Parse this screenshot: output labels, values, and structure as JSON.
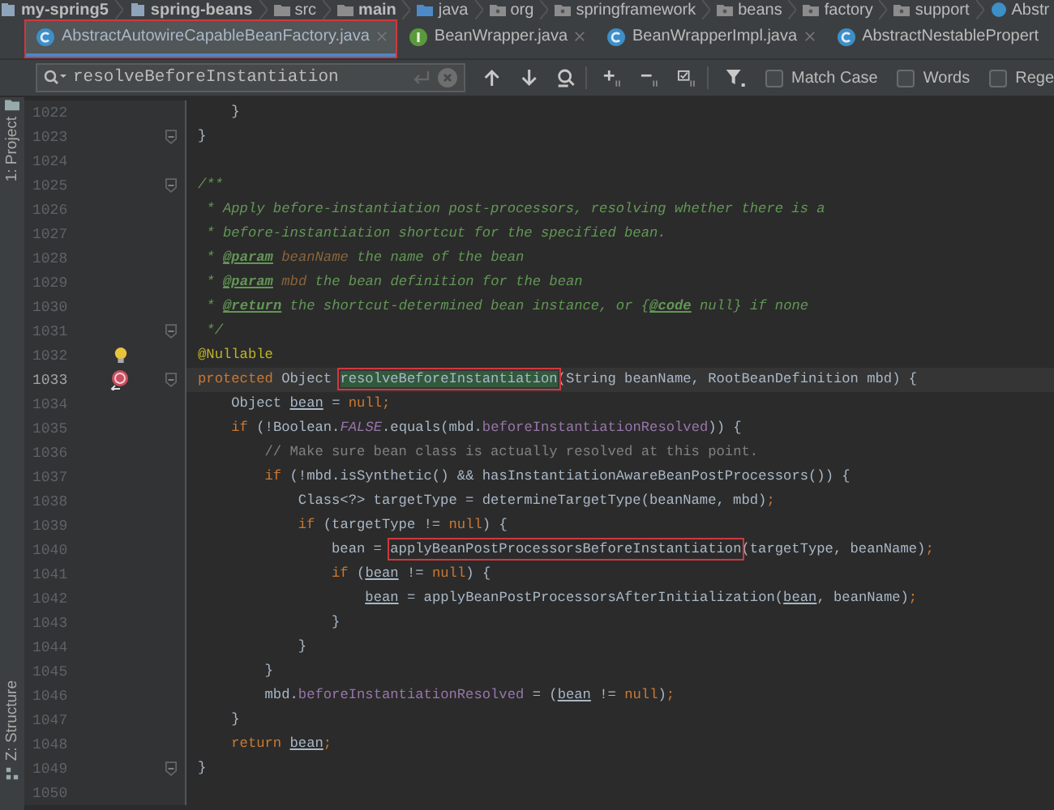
{
  "breadcrumbs": [
    {
      "label": "my-spring5",
      "kind": "module"
    },
    {
      "label": "spring-beans",
      "kind": "module"
    },
    {
      "label": "src",
      "kind": "folder"
    },
    {
      "label": "main",
      "kind": "root"
    },
    {
      "label": "java",
      "kind": "source"
    },
    {
      "label": "org",
      "kind": "package"
    },
    {
      "label": "springframework",
      "kind": "package"
    },
    {
      "label": "beans",
      "kind": "package"
    },
    {
      "label": "factory",
      "kind": "package"
    },
    {
      "label": "support",
      "kind": "package"
    },
    {
      "label": "Abstr",
      "kind": "class"
    }
  ],
  "tabs": [
    {
      "label": "AbstractAutowireCapableBeanFactory.java",
      "kind": "class",
      "selected": true,
      "boxed": true,
      "closable": true
    },
    {
      "label": "BeanWrapper.java",
      "kind": "interface",
      "selected": false,
      "boxed": false,
      "closable": true
    },
    {
      "label": "BeanWrapperImpl.java",
      "kind": "class",
      "selected": false,
      "boxed": false,
      "closable": true
    },
    {
      "label": "AbstractNestablePropert",
      "kind": "class",
      "selected": false,
      "boxed": false,
      "closable": false
    }
  ],
  "search": {
    "value": "resolveBeforeInstantiation",
    "options": [
      {
        "label": "Match Case",
        "checked": false
      },
      {
        "label": "Words",
        "checked": false
      },
      {
        "label": "Rege",
        "checked": false
      }
    ]
  },
  "side_tabs": {
    "top": "1: Project",
    "bottom": "Z: Structure"
  },
  "lines": [
    {
      "number": "1022",
      "fold": false,
      "current": false,
      "tokens": [
        {
          "t": "    }",
          "kind": "p"
        }
      ]
    },
    {
      "number": "1023",
      "fold": true,
      "current": false,
      "tokens": [
        {
          "t": "}",
          "kind": "p"
        }
      ]
    },
    {
      "number": "1024",
      "fold": false,
      "current": false
    },
    {
      "number": "1025",
      "fold": true,
      "current": false,
      "tokens": [
        {
          "t": "/**",
          "kind": "d"
        }
      ]
    },
    {
      "number": "1026",
      "fold": false,
      "current": false,
      "tokens": [
        {
          "t": " * Apply before-instantiation post-processors, resolving whether there is a",
          "kind": "d"
        }
      ]
    },
    {
      "number": "1027",
      "fold": false,
      "current": false,
      "tokens": [
        {
          "t": " * before-instantiation shortcut for the specified bean.",
          "kind": "d"
        }
      ]
    },
    {
      "number": "1028",
      "fold": false,
      "current": false,
      "tokens": [
        {
          "t": " * ",
          "kind": "d"
        },
        {
          "t": "@param",
          "kind": "dt"
        },
        {
          "t": " beanName",
          "kind": "dp"
        },
        {
          "t": " the name of the bean",
          "kind": "d"
        }
      ]
    },
    {
      "number": "1029",
      "fold": false,
      "current": false,
      "tokens": [
        {
          "t": " * ",
          "kind": "d"
        },
        {
          "t": "@param",
          "kind": "dt"
        },
        {
          "t": " mbd",
          "kind": "dp"
        },
        {
          "t": " the bean definition for the bean",
          "kind": "d"
        }
      ]
    },
    {
      "number": "1030",
      "fold": false,
      "current": false,
      "tokens": [
        {
          "t": " * ",
          "kind": "d"
        },
        {
          "t": "@return",
          "kind": "dt"
        },
        {
          "t": " the shortcut-determined bean instance, or {",
          "kind": "d"
        },
        {
          "t": "@code",
          "kind": "dt"
        },
        {
          "t": " null} if none",
          "kind": "d"
        }
      ]
    },
    {
      "number": "1031",
      "fold": true,
      "current": false,
      "tokens": [
        {
          "t": " */",
          "kind": "d"
        }
      ]
    },
    {
      "number": "1032",
      "fold": false,
      "current": false,
      "gutter": {
        "kind": "bulb"
      },
      "tokens": [
        {
          "t": "@Nullable",
          "kind": "a"
        }
      ]
    },
    {
      "number": "1033",
      "fold": true,
      "current": true,
      "gutter": {
        "kind": "override"
      },
      "tokens": [
        {
          "t": "protected",
          "kind": "k"
        },
        {
          "t": " Object ",
          "kind": "p"
        },
        {
          "t": "resolveBeforeInstantiation",
          "kind": "m",
          "boxed": true
        },
        {
          "t": "(String beanName, RootBeanDefinition mbd) {",
          "kind": "p"
        }
      ]
    },
    {
      "number": "1034",
      "fold": false,
      "current": false,
      "tokens": [
        {
          "t": "    Object ",
          "kind": "p"
        },
        {
          "t": "bean",
          "kind": "v"
        },
        {
          "t": " = ",
          "kind": "p"
        },
        {
          "t": "null;",
          "kind": "k"
        }
      ]
    },
    {
      "number": "1035",
      "fold": false,
      "current": false,
      "tokens": [
        {
          "t": "    if",
          "kind": "k"
        },
        {
          "t": " (!Boolean.",
          "kind": "p"
        },
        {
          "t": "FALSE",
          "kind": "s"
        },
        {
          "t": ".equals(mbd.",
          "kind": "p"
        },
        {
          "t": "beforeInstantiationResolved",
          "kind": "f"
        },
        {
          "t": ")) {",
          "kind": "p"
        }
      ]
    },
    {
      "number": "1036",
      "fold": false,
      "current": false,
      "tokens": [
        {
          "t": "        // Make sure bean class is actually resolved at this point.",
          "kind": "c"
        }
      ]
    },
    {
      "number": "1037",
      "fold": false,
      "current": false,
      "tokens": [
        {
          "t": "        if",
          "kind": "k"
        },
        {
          "t": " (!mbd.isSynthetic() && hasInstantiationAwareBeanPostProcessors()) {",
          "kind": "p"
        }
      ]
    },
    {
      "number": "1038",
      "fold": false,
      "current": false,
      "tokens": [
        {
          "t": "            Class<?> targetType = determineTargetType(beanName, mbd)",
          "kind": "p"
        },
        {
          "t": ";",
          "kind": "k"
        }
      ]
    },
    {
      "number": "1039",
      "fold": false,
      "current": false,
      "tokens": [
        {
          "t": "            if",
          "kind": "k"
        },
        {
          "t": " (targetType != ",
          "kind": "p"
        },
        {
          "t": "null",
          "kind": "k"
        },
        {
          "t": ") {",
          "kind": "p"
        }
      ]
    },
    {
      "number": "1040",
      "fold": false,
      "current": false,
      "tokens": [
        {
          "t": "                bean = ",
          "kind": "p"
        },
        {
          "t": "applyBeanPostProcessorsBeforeInstantiation",
          "kind": "p",
          "boxed": true
        },
        {
          "t": "(targetType, beanName)",
          "kind": "p"
        },
        {
          "t": ";",
          "kind": "k"
        }
      ]
    },
    {
      "number": "1041",
      "fold": false,
      "current": false,
      "tokens": [
        {
          "t": "                if",
          "kind": "k"
        },
        {
          "t": " (",
          "kind": "p"
        },
        {
          "t": "bean",
          "kind": "v"
        },
        {
          "t": " != ",
          "kind": "p"
        },
        {
          "t": "null",
          "kind": "k"
        },
        {
          "t": ") {",
          "kind": "p"
        }
      ]
    },
    {
      "number": "1042",
      "fold": false,
      "current": false,
      "tokens": [
        {
          "t": "                    bean",
          "kind": "v"
        },
        {
          "t": " = applyBeanPostProcessorsAfterInitialization(",
          "kind": "p"
        },
        {
          "t": "bean",
          "kind": "v"
        },
        {
          "t": ", beanName)",
          "kind": "p"
        },
        {
          "t": ";",
          "kind": "k"
        }
      ]
    },
    {
      "number": "1043",
      "fold": false,
      "current": false,
      "tokens": [
        {
          "t": "                }",
          "kind": "p"
        }
      ]
    },
    {
      "number": "1044",
      "fold": false,
      "current": false,
      "tokens": [
        {
          "t": "            }",
          "kind": "p"
        }
      ]
    },
    {
      "number": "1045",
      "fold": false,
      "current": false,
      "tokens": [
        {
          "t": "        }",
          "kind": "p"
        }
      ]
    },
    {
      "number": "1046",
      "fold": false,
      "current": false,
      "tokens": [
        {
          "t": "        mbd.",
          "kind": "p"
        },
        {
          "t": "beforeInstantiationResolved",
          "kind": "f"
        },
        {
          "t": " = (",
          "kind": "p"
        },
        {
          "t": "bean",
          "kind": "v"
        },
        {
          "t": " != ",
          "kind": "p"
        },
        {
          "t": "null",
          "kind": "k"
        },
        {
          "t": ")",
          "kind": "p"
        },
        {
          "t": ";",
          "kind": "k"
        }
      ]
    },
    {
      "number": "1047",
      "fold": false,
      "current": false,
      "tokens": [
        {
          "t": "    }",
          "kind": "p"
        }
      ]
    },
    {
      "number": "1048",
      "fold": false,
      "current": false,
      "tokens": [
        {
          "t": "    return ",
          "kind": "k"
        },
        {
          "t": "bean",
          "kind": "v"
        },
        {
          "t": ";",
          "kind": "k"
        }
      ]
    },
    {
      "number": "1049",
      "fold": true,
      "current": false,
      "tokens": [
        {
          "t": "}",
          "kind": "p"
        }
      ]
    },
    {
      "number": "1050",
      "fold": false,
      "current": false
    }
  ]
}
